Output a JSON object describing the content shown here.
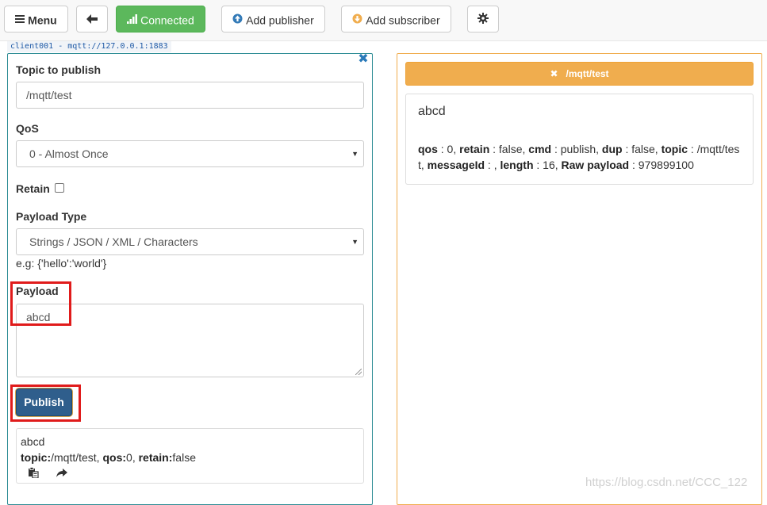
{
  "toolbar": {
    "menu_label": "Menu",
    "connected_label": "Connected",
    "add_publisher_label": "Add publisher",
    "add_subscriber_label": "Add subscriber"
  },
  "client_tag": "client001 - mqtt://127.0.0.1:1883",
  "publisher": {
    "close_glyph": "✖",
    "topic_label": "Topic to publish",
    "topic_value": "/mqtt/test",
    "qos_label": "QoS",
    "qos_value": "0 - Almost Once",
    "retain_label": "Retain",
    "payload_type_label": "Payload Type",
    "payload_type_value": "Strings / JSON / XML / Characters",
    "hint": "e.g: {'hello':'world'}",
    "payload_label": "Payload",
    "payload_value": "abcd",
    "publish_label": "Publish",
    "history": {
      "payload": "abcd",
      "topic_key": "topic:",
      "topic_val": "/mqtt/test,",
      "qos_key": "qos:",
      "qos_val": "0,",
      "retain_key": "retain:",
      "retain_val": "false"
    }
  },
  "subscriber": {
    "topic_glyph": "✖",
    "topic": "/mqtt/test",
    "message": {
      "payload": "abcd",
      "meta": [
        {
          "k": "qos",
          "v": " : 0, "
        },
        {
          "k": "retain",
          "v": " : false, "
        },
        {
          "k": "cmd",
          "v": " : publish, "
        },
        {
          "k": "dup",
          "v": " : false, "
        },
        {
          "k": "topic",
          "v": " : /mqtt/test, "
        },
        {
          "k": "messageId",
          "v": " : , "
        },
        {
          "k": "length",
          "v": " : 16, "
        },
        {
          "k": "Raw payload",
          "v": " : 979899100"
        }
      ]
    }
  },
  "watermark": "https://blog.csdn.net/CCC_122",
  "colors": {
    "connected": "#5cb85c",
    "publisher_border": "#2f8d95",
    "subscriber_accent": "#f0ad4e",
    "publish_button": "#2f5e8c",
    "highlight": "#e01b1b"
  },
  "icons": [
    "hamburger-icon",
    "arrow-left-icon",
    "signal-icon",
    "circle-arrow-up-icon",
    "circle-arrow-down-icon",
    "gear-icon",
    "close-icon",
    "paste-icon",
    "share-icon"
  ]
}
